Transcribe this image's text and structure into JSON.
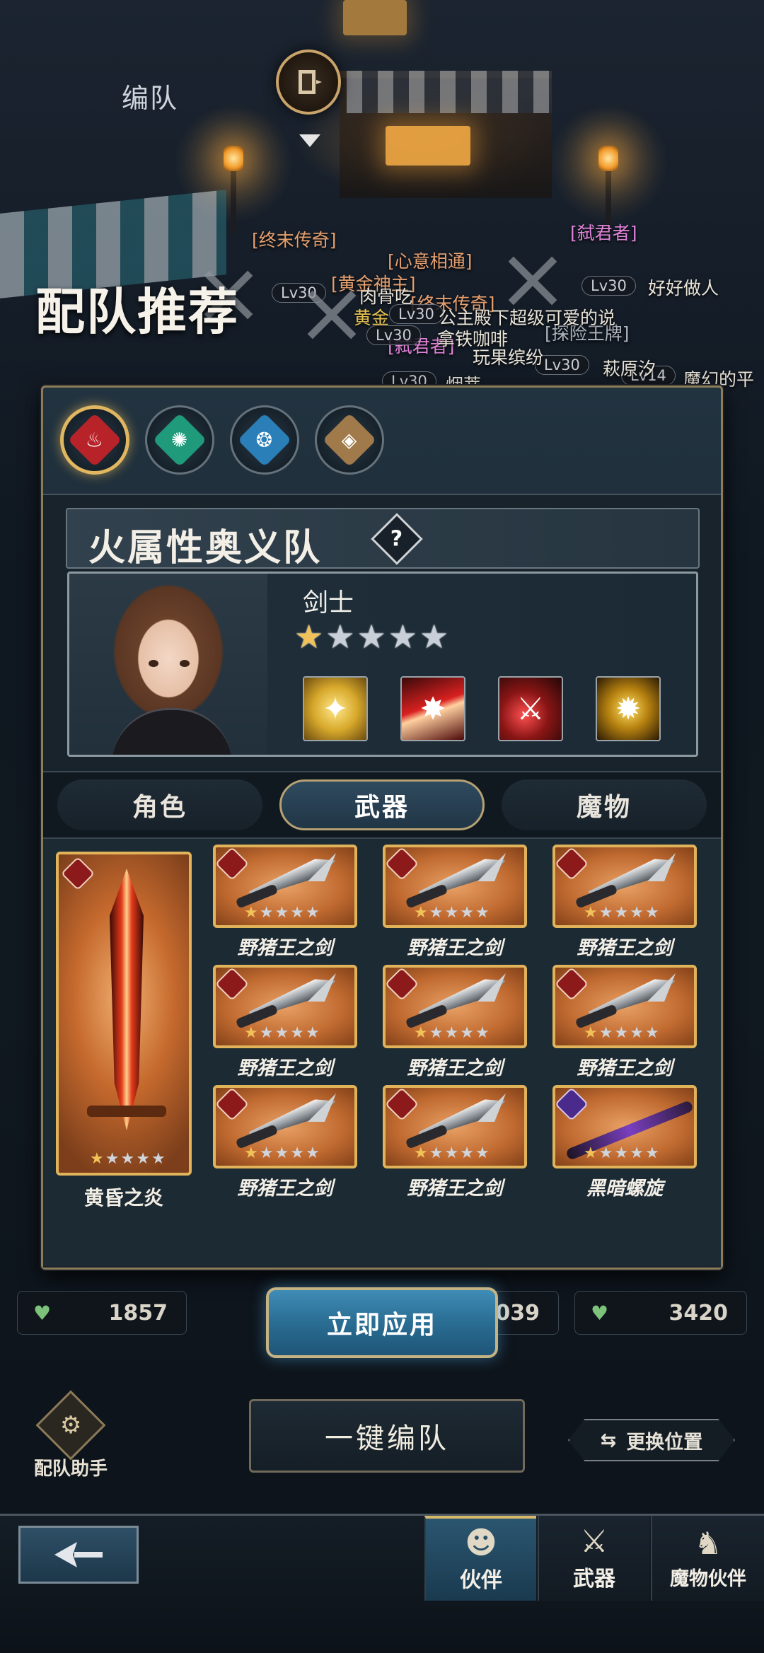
{
  "header": {
    "screen_label": "编队",
    "page_title": "配队推荐"
  },
  "chat": {
    "tags": [
      {
        "text": "[终末传奇]",
        "color": "#e6a070"
      },
      {
        "text": "[心意相通]",
        "color": "#e6a070"
      },
      {
        "text": "[弑君者]",
        "color": "#e083d8"
      },
      {
        "text": "[黄金神主]",
        "color": "#e6a070"
      },
      {
        "text": "[终末传奇]",
        "color": "#e6a070"
      },
      {
        "text": "[弑君者]",
        "color": "#e083d8"
      },
      {
        "text": "[探险王牌]",
        "color": "#b0b6c0"
      }
    ],
    "messages": [
      "好好做人",
      "肉骨吃",
      "公主殿下超级可爱的说",
      "黄金",
      "拿铁咖啡",
      "玩果缤纷",
      "萩原汐",
      "魔幻的平",
      "烟蒂"
    ],
    "levels": [
      "Lv30",
      "Lv30",
      "Lv30",
      "Lv30",
      "Lv30",
      "Lv30",
      "Lv14",
      "Lv30"
    ]
  },
  "elements": [
    {
      "name": "fire",
      "icon": "fire-element-icon",
      "glyph": "♨",
      "color": "#b8232a",
      "active": true
    },
    {
      "name": "wind",
      "icon": "wind-element-icon",
      "glyph": "✺",
      "color": "#1f9a7a",
      "active": false
    },
    {
      "name": "water",
      "icon": "water-element-icon",
      "glyph": "❂",
      "color": "#2b7fb8",
      "active": false
    },
    {
      "name": "earth",
      "icon": "earth-element-icon",
      "glyph": "◈",
      "color": "#a07a4a",
      "active": false
    }
  ],
  "team": {
    "title": "火属性奥义队",
    "help": "?"
  },
  "hero": {
    "role": "剑士",
    "stars_gold": 1,
    "stars_total": 5
  },
  "tabs": {
    "character": "角色",
    "weapon": "武器",
    "monster": "魔物",
    "active": "weapon"
  },
  "weapons": {
    "main": {
      "name": "黄昏之炎",
      "stars_gold": 1,
      "stars_total": 5
    },
    "grid": [
      {
        "name": "野猪王之剑",
        "element": "fire",
        "stars_gold": 1
      },
      {
        "name": "野猪王之剑",
        "element": "fire",
        "stars_gold": 1
      },
      {
        "name": "野猪王之剑",
        "element": "fire",
        "stars_gold": 1
      },
      {
        "name": "野猪王之剑",
        "element": "fire",
        "stars_gold": 1
      },
      {
        "name": "野猪王之剑",
        "element": "fire",
        "stars_gold": 1
      },
      {
        "name": "野猪王之剑",
        "element": "fire",
        "stars_gold": 1
      },
      {
        "name": "野猪王之剑",
        "element": "fire",
        "stars_gold": 1
      },
      {
        "name": "野猪王之剑",
        "element": "fire",
        "stars_gold": 1
      },
      {
        "name": "黑暗螺旋",
        "element": "dark",
        "stars_gold": 1
      }
    ]
  },
  "stats": [
    {
      "value": "1857"
    },
    {
      "value": "039"
    },
    {
      "value": "3420"
    }
  ],
  "actions": {
    "apply": "立即应用",
    "auto_team": "一键编队",
    "swap_position": "更换位置",
    "team_helper": "配队助手"
  },
  "bottom_nav": {
    "partner": "伙伴",
    "weapon": "武器",
    "monster_partner": "魔物伙伴"
  }
}
